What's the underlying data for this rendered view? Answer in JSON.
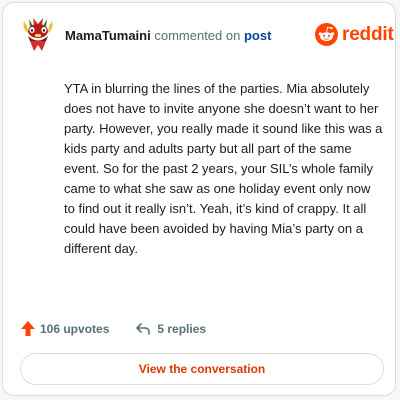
{
  "comment": {
    "author": "MamaTumaini",
    "action_text": "commented on",
    "target_link": "post",
    "body": "YTA in blurring the lines of the parties. Mia absolutely does not have to invite anyone she doesn’t want to her party. However, you really made it sound like this was a kids party and adults party but all part of the same event. So for the past 2 years, your SIL’s whole family came to what she saw as one holiday event only now to find out it really isn’t. Yeah, it’s kind of crappy. It all could have been avoided by having Mia’s party on a different day."
  },
  "brand": {
    "name": "reddit",
    "color": "#ff4500",
    "icon": "reddit-logo-icon"
  },
  "stats": {
    "upvotes_label": "106 upvotes",
    "upvote_icon": "upvote-arrow-icon",
    "upvote_color": "#ff4500",
    "replies_label": "5 replies",
    "reply_icon": "reply-arrow-icon"
  },
  "cta": {
    "label": "View the conversation",
    "color": "#d93a00"
  }
}
